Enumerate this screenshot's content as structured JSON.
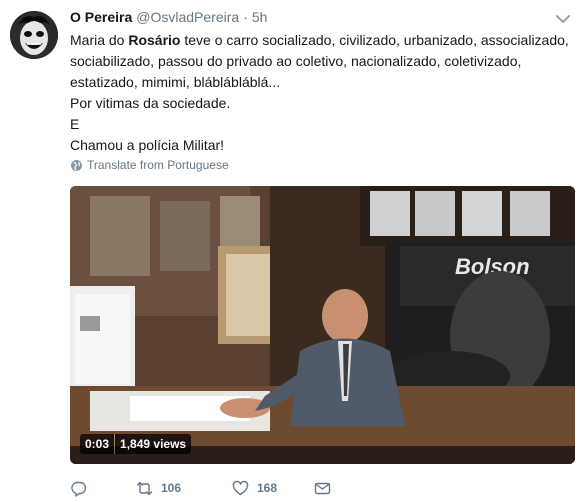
{
  "tweet": {
    "display_name": "O Pereira",
    "handle": "@OsvladPereira",
    "separator": "·",
    "time": "5h",
    "lines": {
      "l1_pre": "Maria do ",
      "l1_bold": "Rosário",
      "l1_post": " teve o carro socializado, civilizado, urbanizado, assocializado,",
      "l2": "sociabilizado, passou do privado ao coletivo, nacionalizado, coletivizado,",
      "l3": "estatizado, mimimi, bláblábláblá...",
      "l4": "Por vitimas da sociedade.",
      "l5": "E",
      "l6": "Chamou a polícia Militar!"
    },
    "translate_label": "Translate from Portuguese",
    "media": {
      "overlay_text": "Bolson",
      "duration": "0:03",
      "views": "1,849 views"
    },
    "actions": {
      "retweets": "106",
      "likes": "168"
    }
  },
  "colors": {
    "text": "#14171a",
    "secondary": "#657786",
    "background": "#ffffff"
  },
  "icons": [
    "caret-down-icon",
    "globe-icon",
    "reply-icon",
    "retweet-icon",
    "like-icon",
    "dm-icon"
  ]
}
